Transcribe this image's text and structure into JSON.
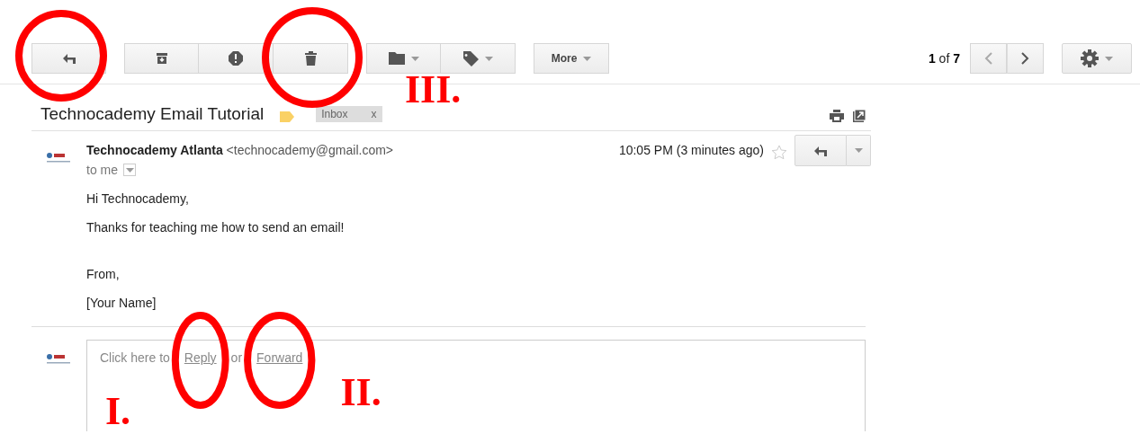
{
  "toolbar": {
    "groups": [
      [
        {
          "kind": "back"
        }
      ],
      [
        {
          "kind": "archive"
        },
        {
          "kind": "spam"
        },
        {
          "kind": "delete"
        }
      ],
      [
        {
          "kind": "move"
        },
        {
          "kind": "labels"
        }
      ],
      [
        {
          "kind": "text",
          "label": "More"
        }
      ]
    ],
    "pager": {
      "current": "1",
      "of": "of",
      "total": "7"
    }
  },
  "conversation": {
    "subject": "Technocademy Email Tutorial",
    "label": "Inbox",
    "label_close": "x",
    "message": {
      "sender": "Technocademy Atlanta",
      "address": "<technocademy@gmail.com>",
      "recipient": "to me",
      "time": "10:05 PM (3 minutes ago)",
      "starred": false,
      "body": [
        "Hi Technocademy,",
        "Thanks for teaching me how to send an email!",
        "From,",
        "[Your Name]"
      ]
    },
    "reply_box": {
      "before": "Click here to",
      "reply": "Reply",
      "middle": "or",
      "forward": "Forward"
    }
  },
  "annotations": [
    {
      "kind": "circle"
    },
    {
      "kind": "circle",
      "label": "III."
    },
    {
      "kind": "ellipse",
      "label": "I."
    },
    {
      "kind": "ellipse",
      "label": "II."
    }
  ]
}
